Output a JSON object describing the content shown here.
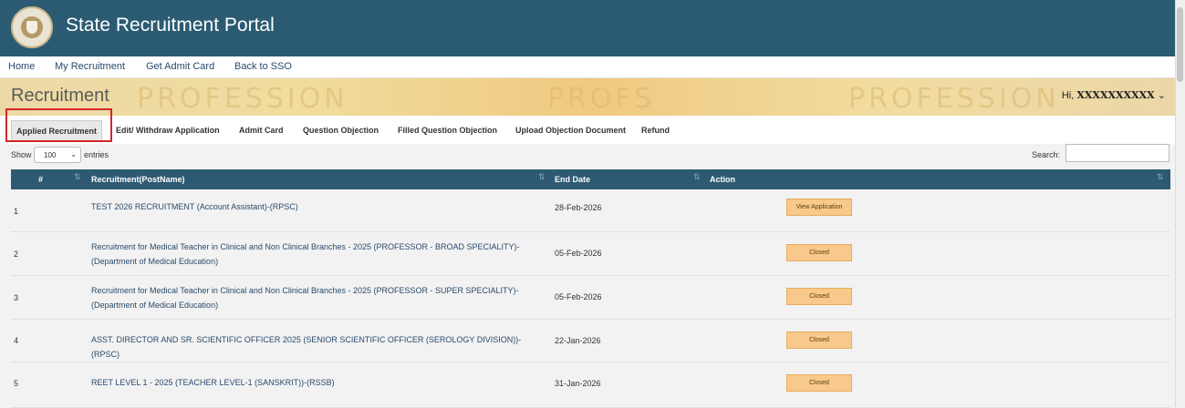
{
  "app": {
    "title": "State Recruitment Portal",
    "logo_icon": "state-emblem-icon"
  },
  "menu": [
    "Home",
    "My Recruitment",
    "Get Admit Card",
    "Back to SSO"
  ],
  "banner": {
    "title": "Recruitment",
    "greeting": "Hi,",
    "username": "XXXXXXXXXX",
    "dropdown_icon": "chevron-down-icon"
  },
  "tabs": [
    "Applied Recruitment",
    "Edit/ Withdraw Application",
    "Admit Card",
    "Question Objection",
    "Filled Question Objection",
    "Upload Objection Document",
    "Refund"
  ],
  "active_tab": "Applied Recruitment",
  "controls": {
    "show_label": "Show",
    "page_size": "100",
    "entries_label": "entries",
    "search_label": "Search:"
  },
  "table": {
    "headers": [
      "#",
      "Recruitment(PostName)",
      "End Date",
      "Action"
    ],
    "rows": [
      {
        "num": "1",
        "post": "TEST 2026 RECRUITMENT (Account Assistant)-(RPSC)",
        "end": "28-Feb-2026",
        "action": "View Application"
      },
      {
        "num": "2",
        "post": "Recruitment for Medical Teacher in Clinical and Non Clinical Branches - 2025 (PROFESSOR - BROAD SPECIALITY)-(Department of Medical Education)",
        "end": "05-Feb-2026",
        "action": "Closed"
      },
      {
        "num": "3",
        "post": "Recruitment for Medical Teacher in Clinical and Non Clinical Branches - 2025 (PROFESSOR - SUPER SPECIALITY)-(Department of Medical Education)",
        "end": "05-Feb-2026",
        "action": "Closed"
      },
      {
        "num": "4",
        "post": "ASST. DIRECTOR AND SR. SCIENTIFIC OFFICER 2025 (SENIOR SCIENTIFIC OFFICER (SEROLOGY DIVISION))-(RPSC)",
        "end": "22-Jan-2026",
        "action": "Closed"
      },
      {
        "num": "5",
        "post": "REET LEVEL 1 - 2025 (TEACHER LEVEL-1 (SANSKRIT))-(RSSB)",
        "end": "31-Jan-2026",
        "action": "Closed"
      }
    ]
  },
  "colors": {
    "header": "#2b5b72",
    "table_head": "#2d5a72",
    "action_button": "#f8c98a",
    "highlight": "#d3262a"
  }
}
